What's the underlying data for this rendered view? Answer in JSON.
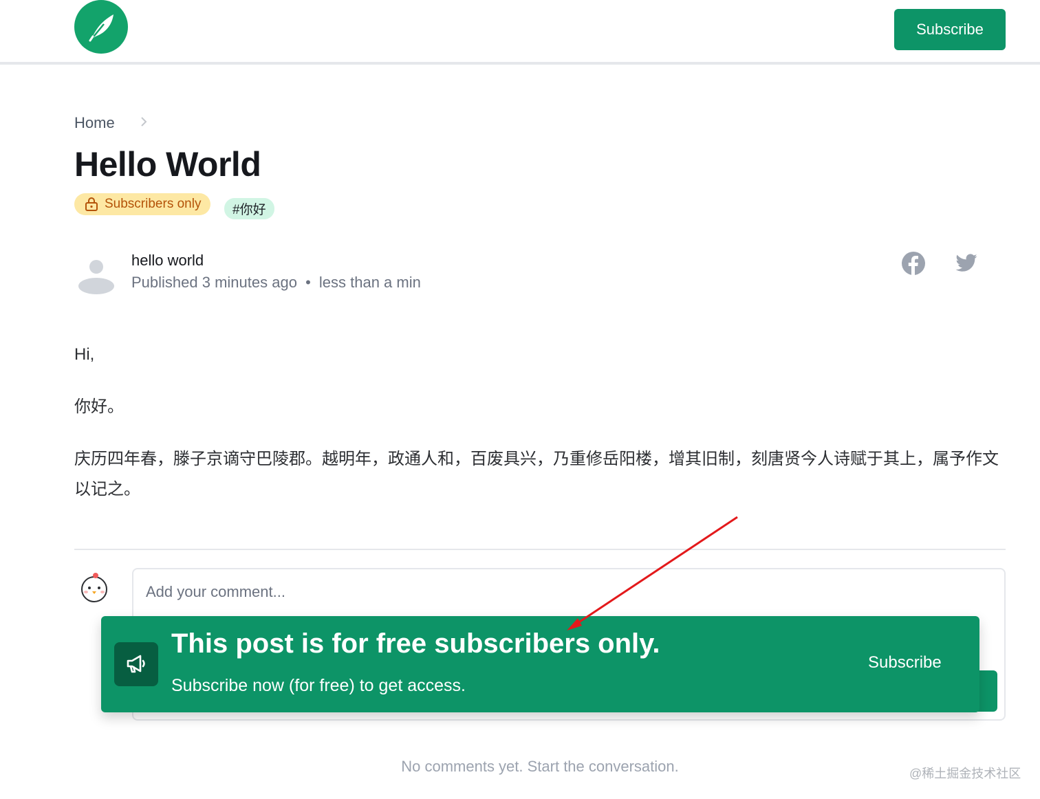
{
  "header": {
    "logo_icon": "feather-icon",
    "subscribe_label": "Subscribe",
    "brand_color": "#0d9467"
  },
  "breadcrumb": {
    "home": "Home",
    "separator_icon": "chevron-right-icon"
  },
  "post": {
    "title": "Hello World",
    "badge_subscribers": "Subscribers only",
    "badge_icon": "lock-icon",
    "tag": "#你好",
    "author": "hello world",
    "published": "Published 3 minutes ago",
    "bullet": "•",
    "read_time": "less than a min",
    "share_icons": [
      "facebook-icon",
      "twitter-icon"
    ],
    "paragraphs": [
      "Hi,",
      "你好。",
      "庆历四年春，滕子京谪守巴陵郡。越明年，政通人和，百废具兴，乃重修岳阳楼，增其旧制，刻唐贤今人诗赋于其上，属予作文以记之。"
    ]
  },
  "comments": {
    "placeholder": "Add your comment...",
    "empty_text": "No comments yet. Start the conversation."
  },
  "paywall": {
    "icon": "megaphone-icon",
    "title": "This post is for free subscribers only.",
    "subtitle": "Subscribe now (for free) to get access.",
    "button_label": "Subscribe"
  },
  "annotation": {
    "arrow_color": "#e3191b"
  },
  "watermark": "@稀土掘金技术社区"
}
